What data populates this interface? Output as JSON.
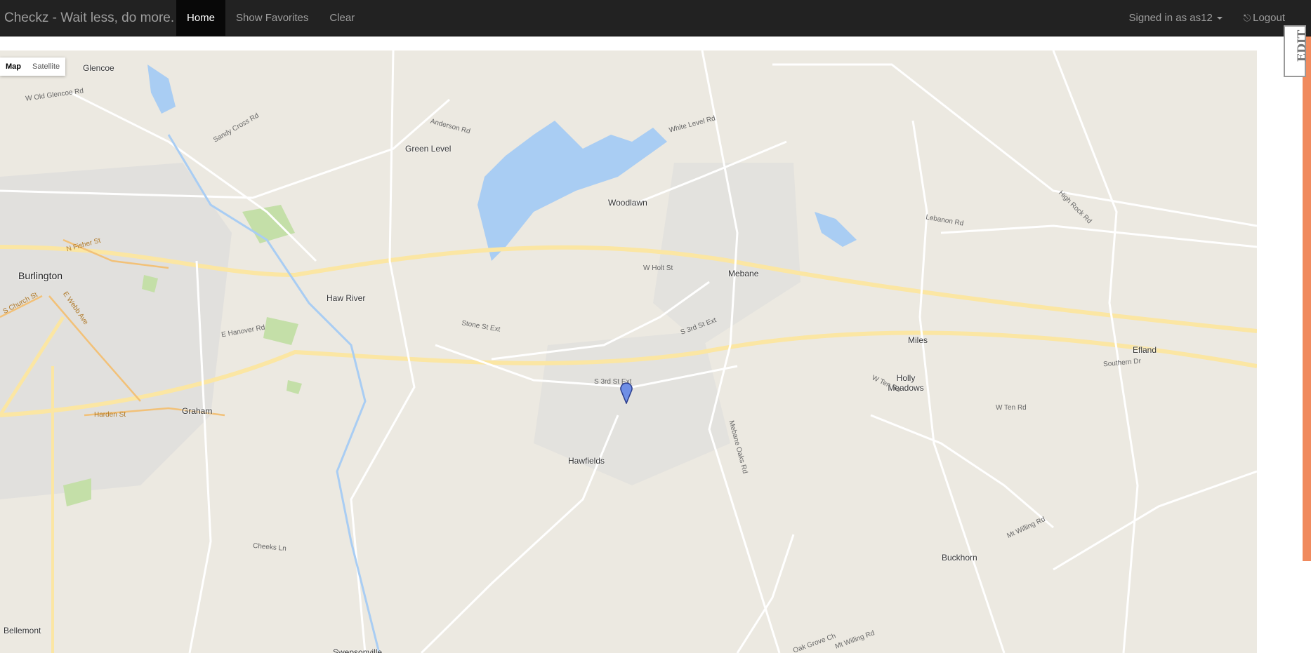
{
  "navbar": {
    "brand": "Checkz - Wait less, do more.",
    "items": [
      "Home",
      "Show Favorites",
      "Clear"
    ],
    "user_label": "Signed in as as12",
    "logout_label": "Logout"
  },
  "map": {
    "type_buttons": [
      "Map",
      "Satellite"
    ],
    "places": [
      {
        "name": "Glencoe",
        "big": false
      },
      {
        "name": "Burlington",
        "big": true
      },
      {
        "name": "Green Level",
        "big": false
      },
      {
        "name": "Woodlawn",
        "big": false
      },
      {
        "name": "Haw River",
        "big": false
      },
      {
        "name": "Mebane",
        "big": false
      },
      {
        "name": "Graham",
        "big": false
      },
      {
        "name": "Hawfields",
        "big": false
      },
      {
        "name": "Miles",
        "big": false
      },
      {
        "name": "Holly Meadows",
        "big": false
      },
      {
        "name": "Efland",
        "big": false
      },
      {
        "name": "Buckhorn",
        "big": false
      },
      {
        "name": "Bellemont",
        "big": false
      },
      {
        "name": "Swepsonville",
        "big": false
      }
    ],
    "roads": [
      "N Fisher St",
      "S Church St",
      "E Webb Ave",
      "Harden St",
      "W Old Glencoe Rd",
      "Sandy Cross Rd",
      "Anderson Rd",
      "White Level Rd",
      "Lebanon Rd",
      "High Rock Rd",
      "W Holt St",
      "Stone St Ext",
      "S 3rd St Ext",
      "S 3rd St Ext",
      "E Hanover Rd",
      "W Ten Rd",
      "W Ten Rd",
      "Mebane Oaks Rd",
      "Southern Dr",
      "Mt Willing Rd",
      "Cheeks Ln",
      "Oak Grove Ch",
      "Mt Willing Rd"
    ],
    "marker_icon": "map-pin-icon"
  },
  "edit_tab": "EDIT"
}
